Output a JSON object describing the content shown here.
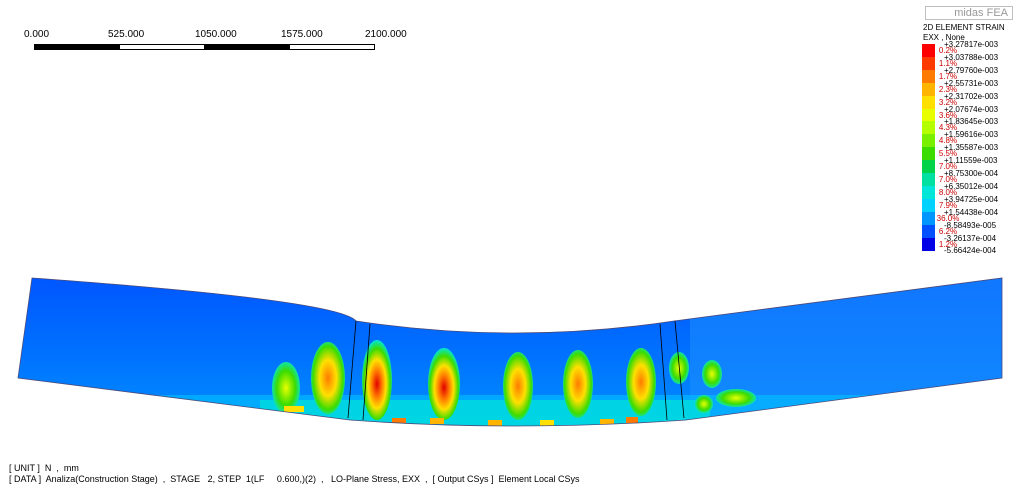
{
  "scale": {
    "labels": [
      "0.000",
      "525.000",
      "1050.000",
      "1575.000",
      "2100.000"
    ]
  },
  "logo": {
    "text": "midas FEA"
  },
  "legend": {
    "title": "2D ELEMENT STRAIN",
    "subtitle": "EXX , None",
    "values": [
      "+3.27817e-003",
      "+3.03788e-003",
      "+2.79760e-003",
      "+2.55731e-003",
      "+2.31702e-003",
      "+2.07674e-003",
      "+1.83645e-003",
      "+1.59616e-003",
      "+1.35587e-003",
      "+1.11559e-003",
      "+8.75300e-004",
      "+6.35012e-004",
      "+3.94725e-004",
      "+1.54438e-004",
      "-8.58493e-005",
      "-3.26137e-004",
      "-5.66424e-004"
    ],
    "percents": [
      "0.2%",
      "1.1%",
      "1.7%",
      "2.3%",
      "3.2%",
      "3.6%",
      "4.3%",
      "4.8%",
      "5.5%",
      "7.0%",
      "7.0%",
      "8.0%",
      "7.9%",
      "36.0%",
      "6.2%",
      "1.2%"
    ],
    "colors": [
      "#ff0000",
      "#ff3a00",
      "#ff7a00",
      "#ffb400",
      "#ffe000",
      "#e8ff00",
      "#b4ff00",
      "#78f000",
      "#3cdc00",
      "#00d24a",
      "#00e0a0",
      "#00e6d8",
      "#00d2ff",
      "#0096ff",
      "#0050ff",
      "#0000e6"
    ]
  },
  "footer": {
    "unit": "[ UNIT ]  N  ,  mm",
    "data": "[ DATA ]  Analiza(Construction Stage)  ,  STAGE   2, STEP  1(LF     0.600,)(2)  ,   LO-Plane Stress, EXX  ,  [ Output CSys ]  Element Local CSys"
  },
  "colors": {
    "beam_base": "#0073ff",
    "beam_light": "#1a8cff",
    "beam_dark": "#0052e6"
  }
}
